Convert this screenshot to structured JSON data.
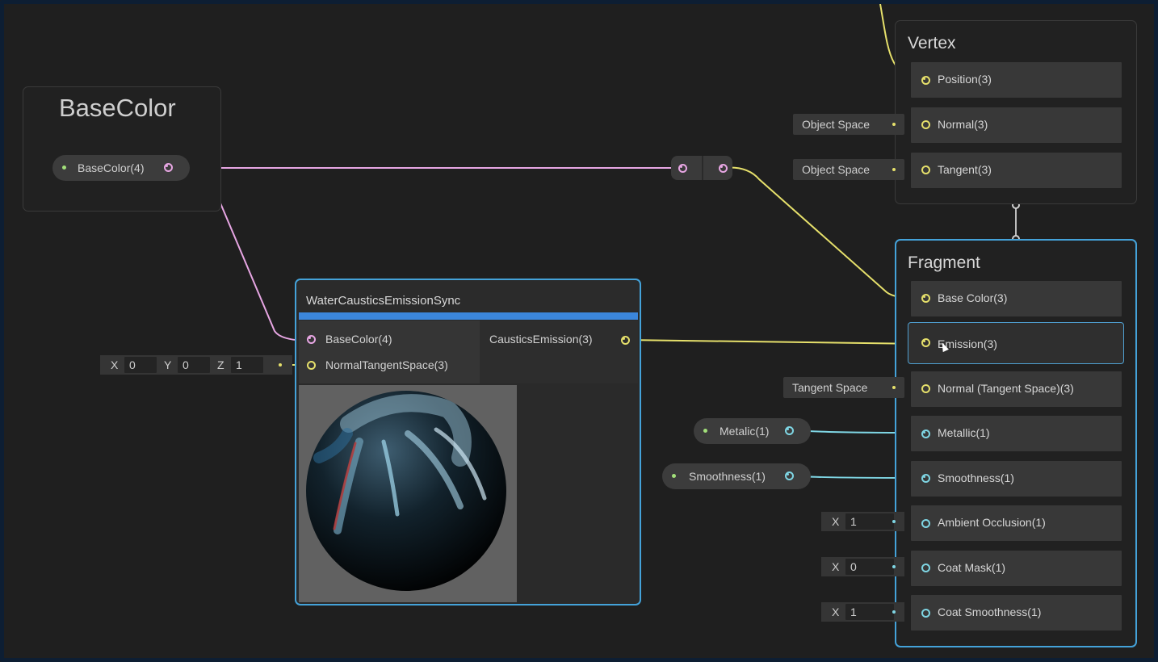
{
  "basecolor_node": {
    "title": "BaseColor",
    "output_label": "BaseColor(4)"
  },
  "vertex_node": {
    "title": "Vertex",
    "slots": [
      {
        "label": "Position(3)"
      },
      {
        "label": "Normal(3)",
        "space": "Object Space"
      },
      {
        "label": "Tangent(3)",
        "space": "Object Space"
      }
    ]
  },
  "fragment_node": {
    "title": "Fragment",
    "slots": [
      {
        "label": "Base Color(3)"
      },
      {
        "label": "Emission(3)"
      },
      {
        "label": "Normal (Tangent Space)(3)",
        "space": "Tangent Space"
      },
      {
        "label": "Metallic(1)"
      },
      {
        "label": "Smoothness(1)"
      },
      {
        "label": "Ambient Occlusion(1)",
        "axis": "X",
        "value": "1"
      },
      {
        "label": "Coat Mask(1)",
        "axis": "X",
        "value": "0"
      },
      {
        "label": "Coat Smoothness(1)",
        "axis": "X",
        "value": "1"
      }
    ]
  },
  "function_node": {
    "title": "WaterCausticsEmissionSync",
    "inputs": [
      "BaseColor(4)",
      "NormalTangentSpace(3)"
    ],
    "output": "CausticsEmission(3)",
    "normal_default": {
      "x_label": "X",
      "x": "0",
      "y_label": "Y",
      "y": "0",
      "z_label": "Z",
      "z": "1"
    }
  },
  "property_nodes": {
    "metallic": "Metalic(1)",
    "smoothness": "Smoothness(1)"
  },
  "colors": {
    "background": "#1f1f1f",
    "selection_blue": "#44a2d9",
    "vector3_wire": "#e6e06b",
    "vector4_wire": "#e7a6e3",
    "float_wire": "#7fd6e4",
    "func_bar": "#3b86db"
  }
}
